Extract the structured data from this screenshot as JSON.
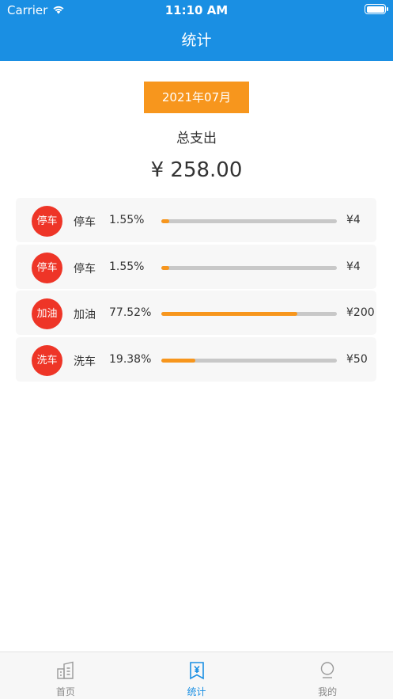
{
  "status_bar": {
    "carrier": "Carrier",
    "time": "11:10 AM"
  },
  "nav": {
    "title": "统计"
  },
  "summary": {
    "month": "2021年07月",
    "total_label": "总支出",
    "total_amount": "¥ 258.00"
  },
  "expenses": [
    {
      "badge": "停车",
      "name": "停车",
      "percent": "1.55%",
      "fraction": 0.0155,
      "amount": "¥4"
    },
    {
      "badge": "停车",
      "name": "停车",
      "percent": "1.55%",
      "fraction": 0.0155,
      "amount": "¥4"
    },
    {
      "badge": "加油",
      "name": "加油",
      "percent": "77.52%",
      "fraction": 0.7752,
      "amount": "¥200"
    },
    {
      "badge": "洗车",
      "name": "洗车",
      "percent": "19.38%",
      "fraction": 0.1938,
      "amount": "¥50"
    }
  ],
  "tabs": [
    {
      "label": "首页",
      "icon": "home-icon"
    },
    {
      "label": "统计",
      "icon": "bill-icon",
      "active": true
    },
    {
      "label": "我的",
      "icon": "profile-icon"
    }
  ],
  "colors": {
    "primary": "#1a8fe3",
    "accent": "#f7961d",
    "badge": "#ee3527",
    "track": "#c8c8c8"
  }
}
